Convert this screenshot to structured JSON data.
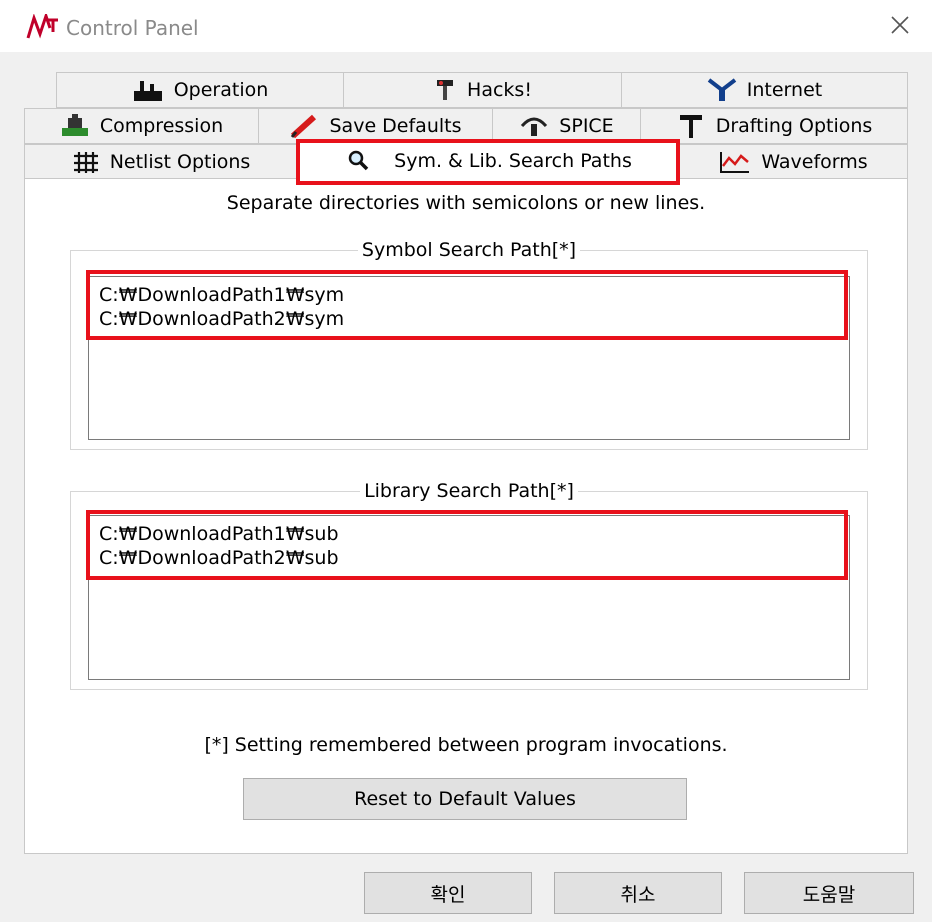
{
  "window": {
    "title": "Control Panel"
  },
  "tabs": {
    "row1": [
      {
        "label": "Operation",
        "icon": "operation-icon"
      },
      {
        "label": "Hacks!",
        "icon": "hacks-icon"
      },
      {
        "label": "Internet",
        "icon": "internet-icon"
      }
    ],
    "row2": [
      {
        "label": "Compression",
        "icon": "compression-icon"
      },
      {
        "label": "Save Defaults",
        "icon": "save-defaults-icon"
      },
      {
        "label": "SPICE",
        "icon": "spice-icon"
      },
      {
        "label": "Drafting Options",
        "icon": "drafting-options-icon"
      }
    ],
    "row3": [
      {
        "label": "Netlist Options",
        "icon": "netlist-options-icon"
      },
      {
        "label": "Sym. & Lib. Search Paths",
        "icon": "search-icon"
      },
      {
        "label": "Waveforms",
        "icon": "waveforms-icon"
      }
    ]
  },
  "panel": {
    "instruction": "Separate directories with semicolons or new lines.",
    "symbol": {
      "label": "Symbol Search Path[*]",
      "value": "C:₩DownloadPath1₩sym\nC:₩DownloadPath2₩sym"
    },
    "library": {
      "label": "Library Search Path[*]",
      "value": "C:₩DownloadPath1₩sub\nC:₩DownloadPath2₩sub"
    },
    "note": "[*] Setting remembered between program invocations.",
    "reset_label": "Reset to Default Values"
  },
  "buttons": {
    "ok": "확인",
    "cancel": "취소",
    "help": "도움말"
  },
  "colors": {
    "highlight": "#e8111b",
    "panel_bg": "#ffffff",
    "window_bg": "#f0f0f0"
  }
}
